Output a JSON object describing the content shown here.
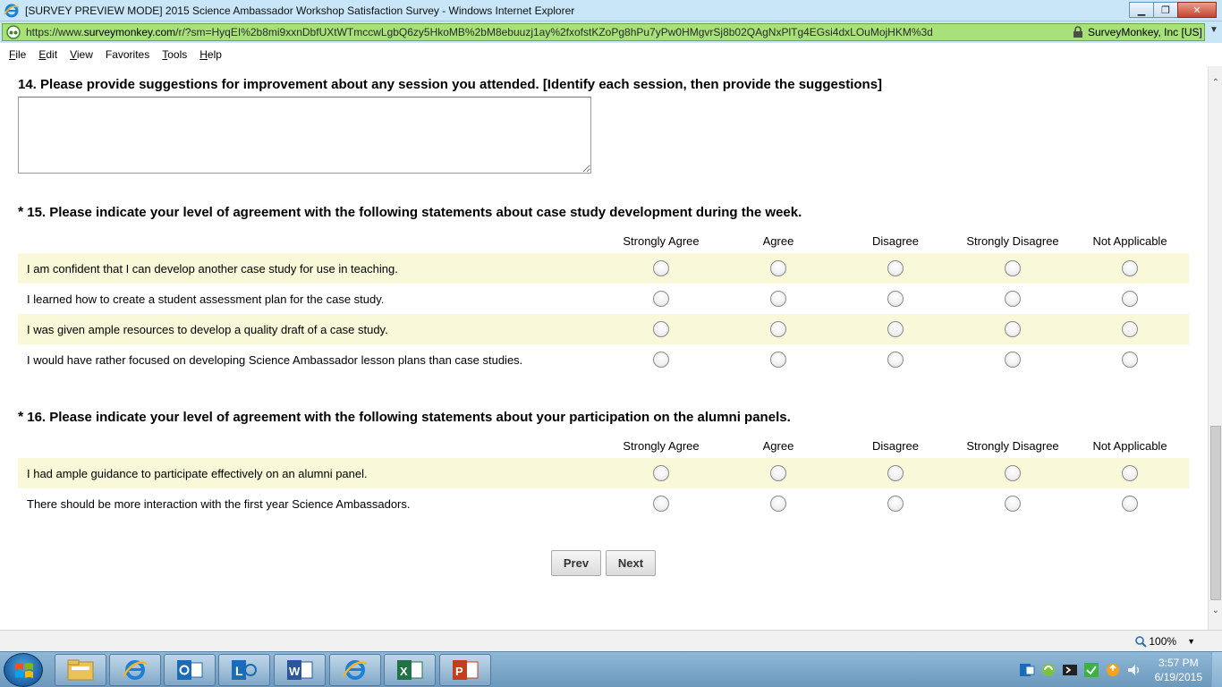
{
  "window": {
    "title": "[SURVEY PREVIEW MODE] 2015 Science Ambassador Workshop Satisfaction Survey - Windows Internet Explorer",
    "minimize": "▁",
    "restore": "❐",
    "close": "✕"
  },
  "address": {
    "url_prefix": "https://www.",
    "url_host": "surveymonkey.com",
    "url_path": "/r/?sm=HyqEI%2b8mi9xxnDbfUXtWTmccwLgbQ6zy5HkoMB%2bM8ebuuzj1ay%2fxofstKZoPg8hPu7yPw0HMgvrSj8b02QAgNxPlTg4EGsi4dxLOuMojHKM%3d",
    "cert": "SurveyMonkey, Inc [US]"
  },
  "menu": {
    "items": [
      {
        "underline": "F",
        "rest": "ile"
      },
      {
        "underline": "E",
        "rest": "dit"
      },
      {
        "underline": "V",
        "rest": "iew"
      },
      {
        "underline": "",
        "rest": "Favorites"
      },
      {
        "underline": "T",
        "rest": "ools"
      },
      {
        "underline": "H",
        "rest": "elp"
      }
    ]
  },
  "q14": {
    "title": "14. Please provide suggestions for improvement about any session you attended. [Identify each session, then provide the suggestions]",
    "value": ""
  },
  "q15": {
    "required": "*",
    "title": "15. Please indicate your level of agreement with the following statements about case study development during the week.",
    "columns": [
      "Strongly Agree",
      "Agree",
      "Disagree",
      "Strongly Disagree",
      "Not Applicable"
    ],
    "rows": [
      "I am confident that I can develop another case study for use in teaching.",
      "I learned how to create a student assessment plan for the case study.",
      "I was given ample resources to develop a quality draft of a case study.",
      "I would have rather focused on developing Science Ambassador lesson plans than case studies."
    ]
  },
  "q16": {
    "required": "*",
    "title": "16. Please indicate your level of agreement with the following statements about your participation on the alumni panels.",
    "columns": [
      "Strongly Agree",
      "Agree",
      "Disagree",
      "Strongly Disagree",
      "Not Applicable"
    ],
    "rows": [
      "I had ample guidance to participate effectively on an alumni panel.",
      "There should be more interaction with the first year Science Ambassadors."
    ]
  },
  "nav": {
    "prev": "Prev",
    "next": "Next"
  },
  "scroll": {
    "up": "⌃",
    "down": "⌄"
  },
  "status": {
    "zoom": "100%",
    "zoom_caret": "▼"
  },
  "clock": {
    "time": "3:57 PM",
    "date": "6/19/2015"
  },
  "icons": {
    "window": "ie-icon",
    "site": "surveymonkey-icon",
    "lock": "lock-icon",
    "zoom": "magnifier-icon",
    "tray": [
      "outlook-tray-icon",
      "sync-icon",
      "network-icon",
      "checkmark-icon",
      "update-icon",
      "volume-icon"
    ]
  },
  "colors": {
    "title_bar": "#c8e6f7",
    "address_green": "#a8e07a",
    "alt_row": "#f9f9d9",
    "taskbar": "#6b98bd"
  }
}
